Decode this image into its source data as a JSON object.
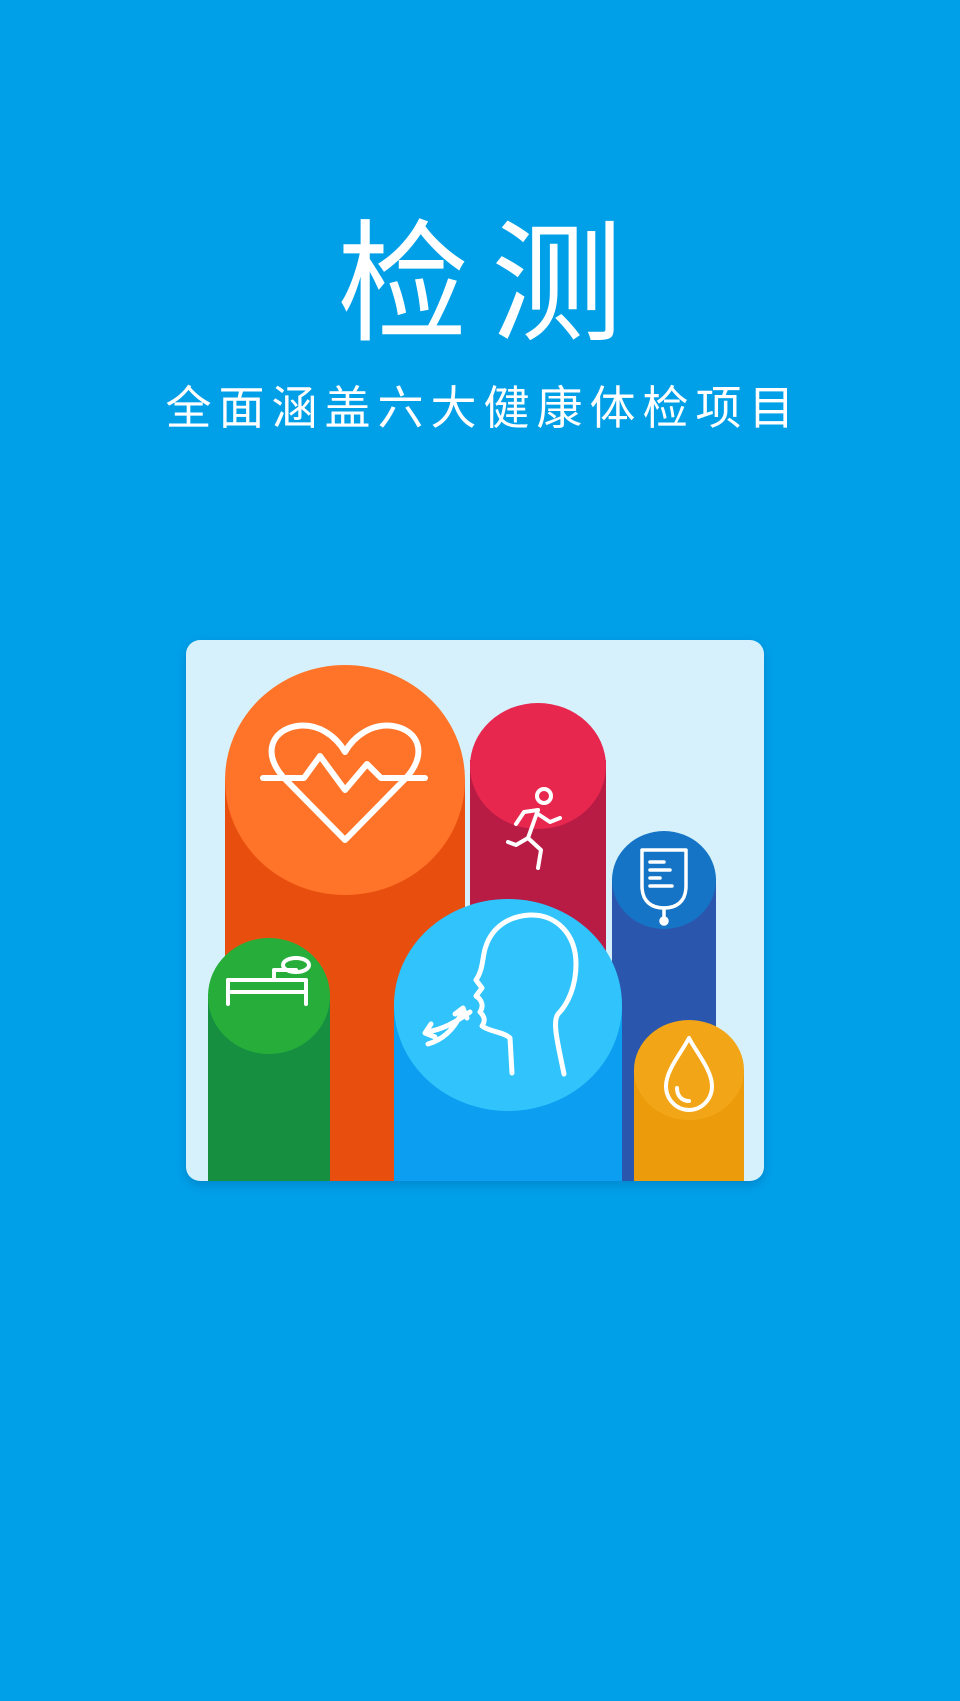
{
  "screen": {
    "title": "检测",
    "subtitle": "全面涵盖六大健康体检项目"
  },
  "illustration": {
    "items": [
      {
        "icon": "heart-rate-icon",
        "color": "#ff7428"
      },
      {
        "icon": "running-person-icon",
        "color": "#e8274f"
      },
      {
        "icon": "iv-drip-icon",
        "color": "#1574c5"
      },
      {
        "icon": "bed-icon",
        "color": "#27ae3a"
      },
      {
        "icon": "breathing-head-icon",
        "color": "#31c3fb"
      },
      {
        "icon": "water-drop-icon",
        "color": "#f2a617"
      }
    ]
  },
  "colors": {
    "background": "#00a0e9",
    "card": "#d6f1fb",
    "text": "#ffffff"
  }
}
